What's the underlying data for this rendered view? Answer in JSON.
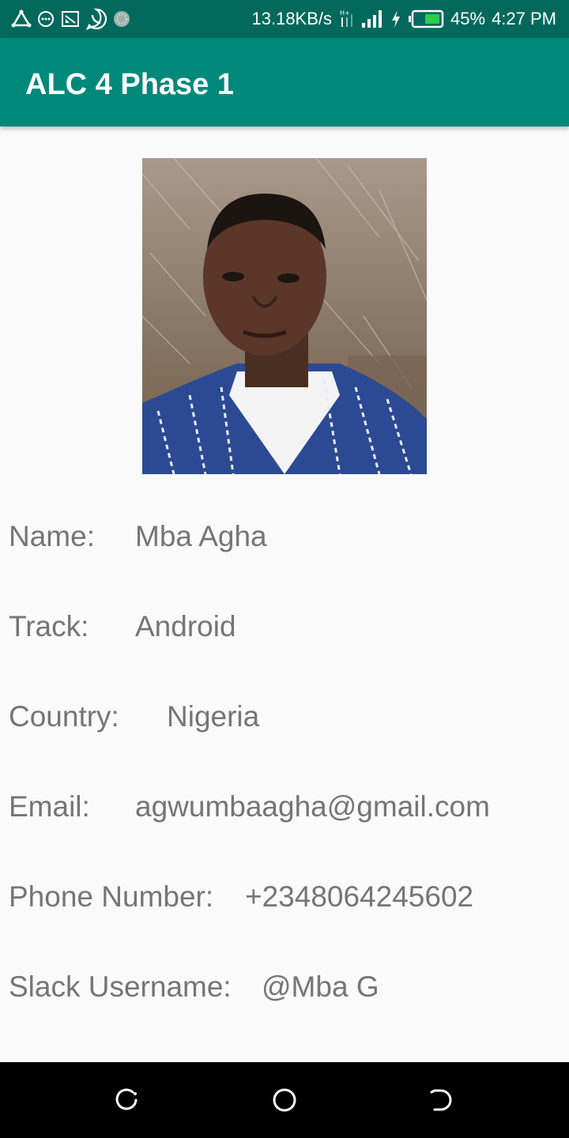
{
  "status_bar": {
    "network_speed": "13.18KB/s",
    "battery_percent": "45%",
    "time": "4:27 PM",
    "icons": [
      "app-triangle-icon",
      "chat-bubble-icon",
      "cast-icon",
      "whatsapp-icon",
      "globe-icon",
      "data-arrows-icon",
      "signal-icon",
      "charging-icon",
      "battery-icon"
    ]
  },
  "app_bar": {
    "title": "ALC 4 Phase 1"
  },
  "profile": {
    "photo_icon": "profile-photo",
    "rows": [
      {
        "label": "Name:",
        "value": "Mba Agha"
      },
      {
        "label": "Track:",
        "value": "Android"
      },
      {
        "label": "Country:",
        "value": "Nigeria"
      },
      {
        "label": "Email:",
        "value": "agwumbaagha@gmail.com"
      },
      {
        "label": "Phone Number:",
        "value": "+2348064245602"
      },
      {
        "label": "Slack Username:",
        "value": "@Mba G"
      }
    ]
  },
  "nav_bar": {
    "icons": [
      "recent-apps-icon",
      "home-icon",
      "back-icon"
    ]
  },
  "colors": {
    "status_bar": "#00695c",
    "app_bar": "#00897b",
    "background": "#fafafa",
    "text": "#757575",
    "nav_bar": "#000000"
  }
}
